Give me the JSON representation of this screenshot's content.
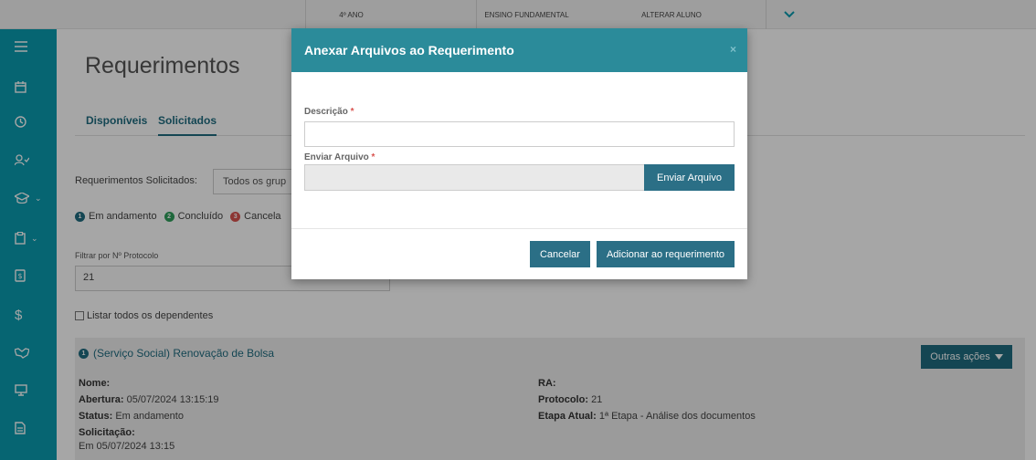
{
  "topbar": {
    "year": "4º ANO",
    "level": "ENSINO FUNDAMENTAL",
    "change_student": "ALTERAR ALUNO"
  },
  "sidebar": {
    "items": [
      "menu-icon",
      "calendar-icon",
      "clock-icon",
      "user-check-icon",
      "graduation-icon",
      "clipboard-icon",
      "receipt-icon",
      "dollar-icon",
      "handshake-icon",
      "monitor-icon",
      "document-icon"
    ]
  },
  "main": {
    "title": "Requerimentos",
    "tabs": [
      {
        "label": "Disponíveis"
      },
      {
        "label": "Solicitados"
      }
    ],
    "requests_label": "Requerimentos Solicitados:",
    "requests_select": "Todos os grup",
    "legend": [
      {
        "num": "1",
        "label": "Em andamento",
        "color": "#1f6c80"
      },
      {
        "num": "2",
        "label": "Concluído",
        "color": "#2e9e5b"
      },
      {
        "num": "3",
        "label": "Cancela",
        "color": "#d9534f"
      }
    ],
    "filter_label": "Filtrar por Nº Protocolo",
    "filter_value": "21",
    "list_all": "Listar todos os dependentes",
    "card": {
      "badge": "1",
      "title": "(Serviço Social) Renovação de Bolsa",
      "more_actions": "Outras ações",
      "nome_label": "Nome:",
      "abertura_label": "Abertura:",
      "abertura_value": "05/07/2024 13:15:19",
      "status_label": "Status:",
      "status_value": "Em andamento",
      "solicitacao_label": "Solicitação:",
      "solicitacao_value": "Em 05/07/2024 13:15",
      "ra_label": "RA:",
      "protocolo_label": "Protocolo:",
      "protocolo_value": "21",
      "etapa_label": "Etapa Atual:",
      "etapa_value": "1ª Etapa - Análise dos documentos"
    }
  },
  "modal": {
    "title": "Anexar Arquivos ao Requerimento",
    "close": "×",
    "descricao_label": "Descrição",
    "enviar_label": "Enviar Arquivo",
    "required_mark": "*",
    "send_file_button": "Enviar Arquivo",
    "cancel_button": "Cancelar",
    "add_button": "Adicionar ao requerimento"
  }
}
